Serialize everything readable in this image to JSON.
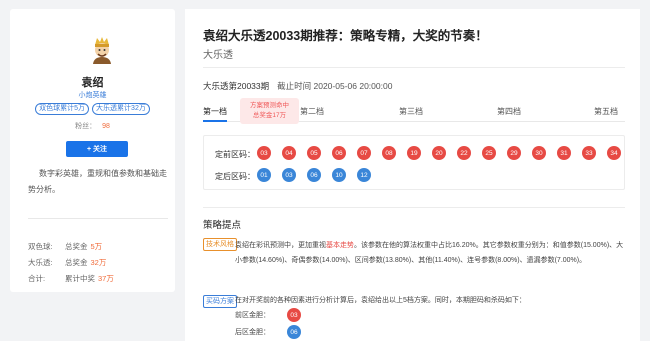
{
  "profile": {
    "name": "袁绍",
    "title": "小炮英雄",
    "tags": [
      "双色球累计5万",
      "大乐透累计32万"
    ],
    "fans_label": "粉丝：",
    "fans": "98",
    "follow_label": "+ 关注",
    "description": "数字彩英雄，重规和值参数和基础走势分析。",
    "stats": [
      {
        "game": "双色球:",
        "label": "总奖金",
        "value": "5万"
      },
      {
        "game": "大乐透:",
        "label": "总奖金",
        "value": "32万"
      },
      {
        "game": "合计:",
        "label": "累计中奖",
        "value": "37万"
      }
    ]
  },
  "article": {
    "title": "袁绍大乐透20033期推荐：策略专精，大奖的节奏！",
    "subtitle": "大乐透",
    "issue": "大乐透第20033期",
    "deadline": "截止时间 2020-05-06 20:00:00",
    "tabs": [
      "第一档",
      "第二档",
      "第三档",
      "第四档",
      "第五档"
    ],
    "tooltip_line1": "方案预测命中",
    "tooltip_line2": "总奖金17万",
    "front_label": "定前区码：",
    "front_numbers": [
      "03",
      "04",
      "05",
      "06",
      "07",
      "08",
      "19",
      "20",
      "22",
      "25",
      "29",
      "30",
      "31",
      "33",
      "34"
    ],
    "back_label": "定后区码：",
    "back_numbers": [
      "01",
      "03",
      "06",
      "10",
      "12"
    ],
    "section_title": "策略提点",
    "badge1": "技术风格",
    "para1_a": "袁绍在彩讯预测中，更加重视",
    "para1_hl": "基本走势",
    "para1_b": "。该参数在他的算法权重中占比16.20%。其它参数权重分别为：和值参数(15.00%)、大小参数(14.60%)、奇偶参数(14.00%)、区间参数(13.80%)、其他(11.40%)、连号参数(8.00%)、遗漏参数(7.00%)。",
    "badge2": "买码方案",
    "para2": "在对开奖前的各种因素进行分析计算后，袁绍给出以上5档方案。同时，本期胆码和杀码如下：",
    "front_dan_label": "前区金胆：",
    "front_dan": "03",
    "back_dan_label": "后区金胆：",
    "back_dan": "06"
  }
}
